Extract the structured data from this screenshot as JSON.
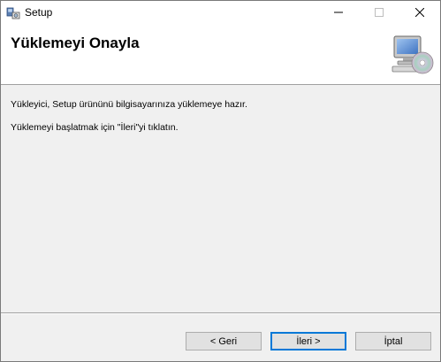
{
  "window": {
    "title": "Setup",
    "controls": {
      "minimize_icon": "minimize-icon",
      "maximize_icon": "maximize-icon",
      "close_icon": "close-icon"
    }
  },
  "header": {
    "title": "Yüklemeyi Onayla",
    "icon": "computer-cd-icon"
  },
  "body": {
    "line1": "Yükleyici, Setup ürününü bilgisayarınıza yüklemeye hazır.",
    "line2": "Yüklemeyi başlatmak için \"İleri\"yi tıklatın."
  },
  "buttons": {
    "back": "< Geri",
    "next": "İleri >",
    "cancel": "İptal"
  },
  "colors": {
    "accent": "#0078d7",
    "dialog_bg": "#f0f0f0",
    "header_bg": "#ffffff"
  }
}
